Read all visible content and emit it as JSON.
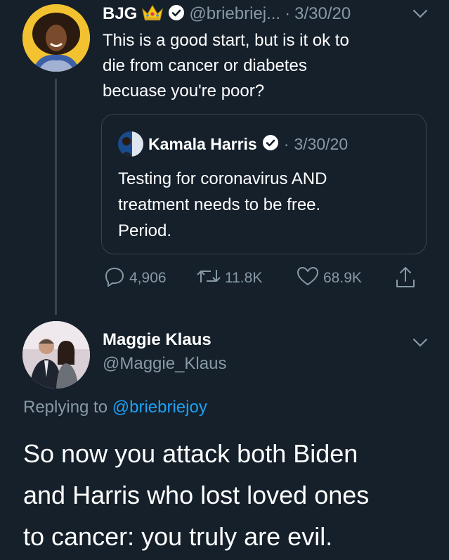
{
  "tweet": {
    "author_name": "BJG",
    "author_handle": "@briebriej...",
    "separator": "·",
    "date": "3/30/20",
    "text_lines": [
      "This is a good start, but is it ok to",
      "die from cancer or diabetes",
      "becuase you're poor?"
    ],
    "icons": [
      "crown-emoji-icon",
      "verified-badge-icon",
      "chevron-down-icon"
    ]
  },
  "quoted_tweet": {
    "author_name": "Kamala Harris",
    "separator": "·",
    "date": "3/30/20",
    "text_lines": [
      "Testing for coronavirus AND",
      "treatment needs to be free.",
      "Period."
    ]
  },
  "actions": {
    "replies": "4,906",
    "retweets": "11.8K",
    "likes": "68.9K"
  },
  "reply": {
    "author_name": "Maggie Klaus",
    "author_handle": "@Maggie_Klaus",
    "replying_prefix": "Replying to",
    "replying_handle": "@briebriejoy",
    "text_lines": [
      "So now you attack both Biden",
      "and Harris who lost loved ones",
      "to cancer: you truly are evil."
    ]
  },
  "colors": {
    "background": "#15202b",
    "muted": "#8899a6",
    "link": "#1da1f2",
    "border": "#38444d"
  }
}
